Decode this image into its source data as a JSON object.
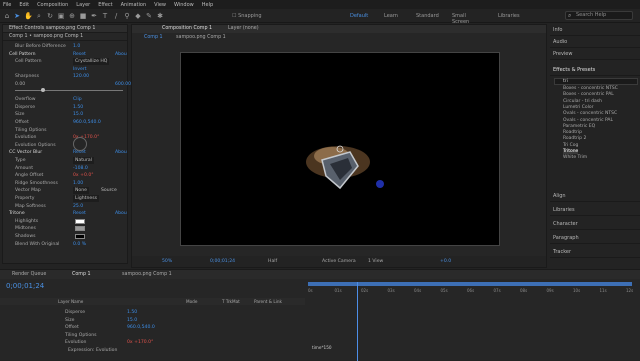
{
  "menu": [
    "File",
    "Edit",
    "Composition",
    "Layer",
    "Effect",
    "Animation",
    "View",
    "Window",
    "Help"
  ],
  "toolbar": {
    "snapping": "Snapping",
    "workspaces": [
      "Default",
      "Learn",
      "Standard",
      "Small Screen",
      "Libraries"
    ],
    "search_placeholder": "Search Help"
  },
  "fx_panel": {
    "tab": "Effect Controls sampoo.png Comp 1",
    "subtitle": "Comp 1 • sampoo.png Comp 1",
    "rows": [
      {
        "label": "Blur Before Difference",
        "value": "1.0"
      },
      {
        "label": "Cell Pattern",
        "value": "Reset",
        "right": "Abou"
      },
      {
        "label": "Cell Pattern",
        "value": "Crystallize HQ"
      },
      {
        "label": "",
        "value": "Invert"
      },
      {
        "label": "Sharpness",
        "value": "120.00"
      },
      {
        "label": "0.00",
        "value": "",
        "right": "600.00"
      },
      {
        "label": "",
        "value": ""
      },
      {
        "label": "Overflow",
        "value": "Clip"
      },
      {
        "label": "Disperse",
        "value": "1.50"
      },
      {
        "label": "Size",
        "value": "15.0"
      },
      {
        "label": "Offset",
        "value": "960.0,540.0"
      },
      {
        "label": "Tiling Options",
        "value": ""
      },
      {
        "label": "Evolution",
        "value": "0x +170.0°"
      },
      {
        "label": "Evolution Options",
        "value": ""
      },
      {
        "label": "CC Vector Blur",
        "value": "Reset",
        "right": "Abou"
      },
      {
        "label": "Type",
        "value": "Natural"
      },
      {
        "label": "Amount",
        "value": "-108.0"
      },
      {
        "label": "Angle Offset",
        "value": "0x +0.0°"
      },
      {
        "label": "Ridge Smoothness",
        "value": "1.00"
      },
      {
        "label": "Vector Map",
        "value": "None"
      },
      {
        "label": "Property",
        "value": "Lightness"
      },
      {
        "label": "Map Softness",
        "value": "25.0"
      },
      {
        "label": "Tritone",
        "value": "Reset",
        "right": "Abou"
      },
      {
        "label": "Highlights",
        "value": ""
      },
      {
        "label": "Midtones",
        "value": ""
      },
      {
        "label": "Shadows",
        "value": ""
      },
      {
        "label": "Blend With Original",
        "value": "0.0 %"
      }
    ],
    "source": "Source"
  },
  "viewer": {
    "tabs": [
      "Comp 1",
      "sampoo.png Comp 1"
    ],
    "comp_tab": "Composition Comp 1",
    "layer_tab": "Layer (none)",
    "zoom": "50%",
    "timecode": "0;00;01;24",
    "quality": "Half",
    "camera": "Active Camera",
    "views": "1 View",
    "exposure": "+0.0"
  },
  "right_panel": {
    "panels": [
      "Info",
      "Audio",
      "Preview",
      "Effects & Presets",
      "Align",
      "Libraries",
      "Character",
      "Paragraph",
      "Tracker"
    ],
    "search": "tri",
    "presets": [
      "Boxes - concentric NTSC",
      "Boxes - concentric PAL",
      "Circular - tri dash",
      "Lumetri Color",
      "Ovals - concentric NTSC",
      "Ovals - concentric PAL",
      "Parametric EQ",
      "Roadtrip",
      "Roadtrip 2",
      "Tri Cog",
      "Tritone",
      "White Trim"
    ]
  },
  "timeline": {
    "tabs": [
      "Render Queue",
      "Comp 1",
      "sampoo.png Comp 1"
    ],
    "timecode": "0;00;01;24",
    "columns": [
      "Layer Name",
      "Mode",
      "T TrkMat",
      "Parent & Link"
    ],
    "rows": [
      {
        "label": "Disperse",
        "value": "1.50"
      },
      {
        "label": "Size",
        "value": "15.0"
      },
      {
        "label": "Offset",
        "value": "960.0,540.0"
      },
      {
        "label": "Tiling Options",
        "value": ""
      },
      {
        "label": "Evolution",
        "value": "0x +170.0°"
      },
      {
        "label": "Expression: Evolution",
        "value": ""
      }
    ],
    "ruler": [
      "0s",
      "01s",
      "02s",
      "03s",
      "04s",
      "05s",
      "06s",
      "07s",
      "08s",
      "09s",
      "10s",
      "11s",
      "12s"
    ],
    "expression": "time*150"
  },
  "colors": {
    "accent": "#3d8ee8",
    "playhead": "#4d8ee8",
    "red": "#e0524b"
  }
}
